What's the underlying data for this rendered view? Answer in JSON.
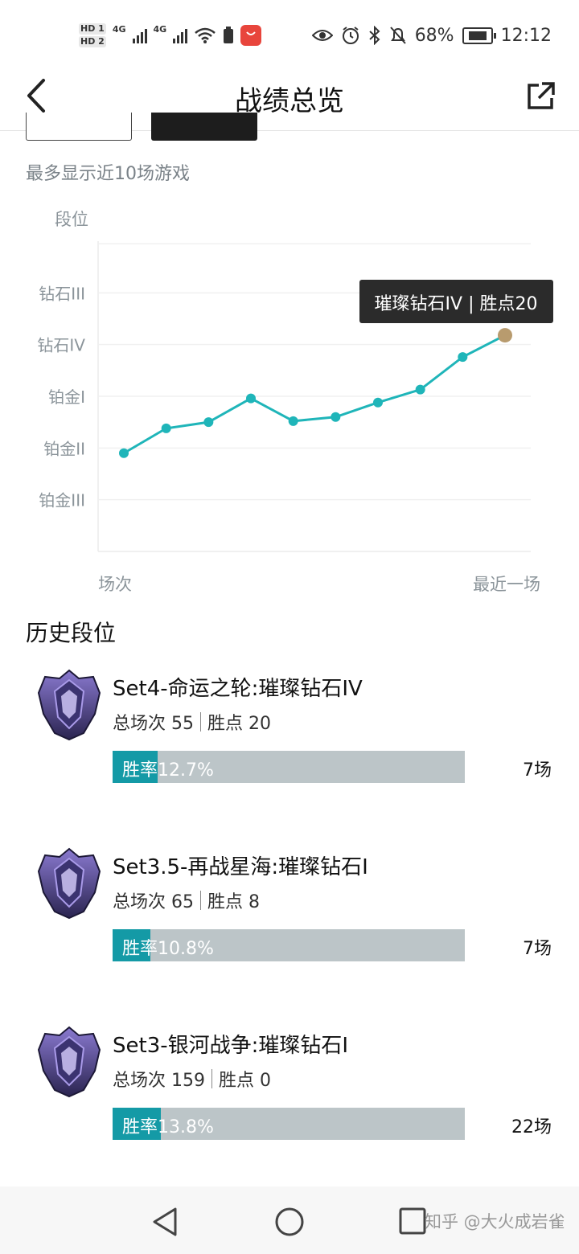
{
  "status_bar": {
    "hd1": "HD 1",
    "hd2": "HD 2",
    "net1": "4G",
    "net2": "4G",
    "battery_percent": "68%",
    "time": "12:12"
  },
  "nav": {
    "title": "战绩总览"
  },
  "hint": "最多显示近10场游戏",
  "chart": {
    "y_title": "段位",
    "x_start_label": "场次",
    "x_end_label": "最近一场",
    "tooltip": "璀璨钻石IV | 胜点20",
    "accent": "#1fb5b9",
    "highlight": "#b89b6e"
  },
  "chart_data": {
    "type": "line",
    "ylabel": "段位",
    "xlabel": "场次",
    "y_ticks": [
      "钻石III",
      "钻石IV",
      "铂金I",
      "铂金II",
      "铂金III"
    ],
    "y_tick_values": [
      4,
      3,
      2,
      1,
      0
    ],
    "ylim": [
      -1,
      5
    ],
    "x": [
      1,
      2,
      3,
      4,
      5,
      6,
      7,
      8,
      9,
      10
    ],
    "values": [
      0.9,
      1.38,
      1.5,
      1.96,
      1.52,
      1.6,
      1.88,
      2.13,
      2.76,
      3.18
    ],
    "grid": true
  },
  "history": {
    "title": "历史段位",
    "seasons": [
      {
        "name": "Set4-命运之轮:璀璨钻石IV",
        "games_label": "总场次 55",
        "points_label": "胜点 20",
        "winrate_label": "胜率12.7%",
        "winrate": 0.127,
        "count": "7场"
      },
      {
        "name": "Set3.5-再战星海:璀璨钻石I",
        "games_label": "总场次 65",
        "points_label": "胜点 8",
        "winrate_label": "胜率10.8%",
        "winrate": 0.108,
        "count": "7场"
      },
      {
        "name": "Set3-银河战争:璀璨钻石I",
        "games_label": "总场次 159",
        "points_label": "胜点 0",
        "winrate_label": "胜率13.8%",
        "winrate": 0.138,
        "count": "22场"
      }
    ]
  },
  "watermark": "知乎 @大火成岩雀"
}
